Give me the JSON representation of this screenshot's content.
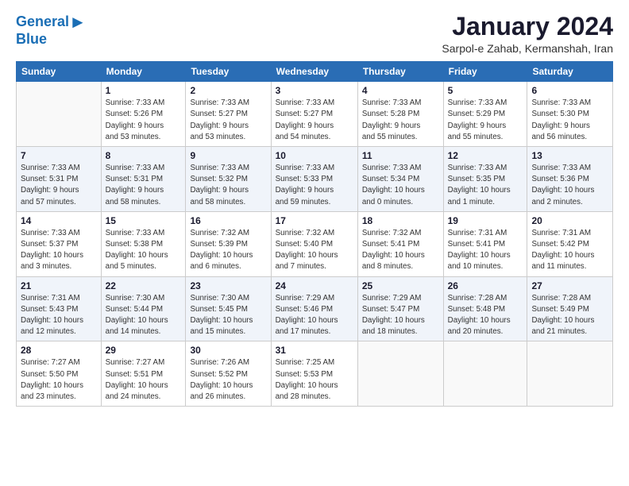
{
  "logo": {
    "line1": "General",
    "line2": "Blue"
  },
  "title": "January 2024",
  "location": "Sarpol-e Zahab, Kermanshah, Iran",
  "weekdays": [
    "Sunday",
    "Monday",
    "Tuesday",
    "Wednesday",
    "Thursday",
    "Friday",
    "Saturday"
  ],
  "weeks": [
    [
      {
        "day": "",
        "info": ""
      },
      {
        "day": "1",
        "info": "Sunrise: 7:33 AM\nSunset: 5:26 PM\nDaylight: 9 hours\nand 53 minutes."
      },
      {
        "day": "2",
        "info": "Sunrise: 7:33 AM\nSunset: 5:27 PM\nDaylight: 9 hours\nand 53 minutes."
      },
      {
        "day": "3",
        "info": "Sunrise: 7:33 AM\nSunset: 5:27 PM\nDaylight: 9 hours\nand 54 minutes."
      },
      {
        "day": "4",
        "info": "Sunrise: 7:33 AM\nSunset: 5:28 PM\nDaylight: 9 hours\nand 55 minutes."
      },
      {
        "day": "5",
        "info": "Sunrise: 7:33 AM\nSunset: 5:29 PM\nDaylight: 9 hours\nand 55 minutes."
      },
      {
        "day": "6",
        "info": "Sunrise: 7:33 AM\nSunset: 5:30 PM\nDaylight: 9 hours\nand 56 minutes."
      }
    ],
    [
      {
        "day": "7",
        "info": "Sunrise: 7:33 AM\nSunset: 5:31 PM\nDaylight: 9 hours\nand 57 minutes."
      },
      {
        "day": "8",
        "info": "Sunrise: 7:33 AM\nSunset: 5:31 PM\nDaylight: 9 hours\nand 58 minutes."
      },
      {
        "day": "9",
        "info": "Sunrise: 7:33 AM\nSunset: 5:32 PM\nDaylight: 9 hours\nand 58 minutes."
      },
      {
        "day": "10",
        "info": "Sunrise: 7:33 AM\nSunset: 5:33 PM\nDaylight: 9 hours\nand 59 minutes."
      },
      {
        "day": "11",
        "info": "Sunrise: 7:33 AM\nSunset: 5:34 PM\nDaylight: 10 hours\nand 0 minutes."
      },
      {
        "day": "12",
        "info": "Sunrise: 7:33 AM\nSunset: 5:35 PM\nDaylight: 10 hours\nand 1 minute."
      },
      {
        "day": "13",
        "info": "Sunrise: 7:33 AM\nSunset: 5:36 PM\nDaylight: 10 hours\nand 2 minutes."
      }
    ],
    [
      {
        "day": "14",
        "info": "Sunrise: 7:33 AM\nSunset: 5:37 PM\nDaylight: 10 hours\nand 3 minutes."
      },
      {
        "day": "15",
        "info": "Sunrise: 7:33 AM\nSunset: 5:38 PM\nDaylight: 10 hours\nand 5 minutes."
      },
      {
        "day": "16",
        "info": "Sunrise: 7:32 AM\nSunset: 5:39 PM\nDaylight: 10 hours\nand 6 minutes."
      },
      {
        "day": "17",
        "info": "Sunrise: 7:32 AM\nSunset: 5:40 PM\nDaylight: 10 hours\nand 7 minutes."
      },
      {
        "day": "18",
        "info": "Sunrise: 7:32 AM\nSunset: 5:41 PM\nDaylight: 10 hours\nand 8 minutes."
      },
      {
        "day": "19",
        "info": "Sunrise: 7:31 AM\nSunset: 5:41 PM\nDaylight: 10 hours\nand 10 minutes."
      },
      {
        "day": "20",
        "info": "Sunrise: 7:31 AM\nSunset: 5:42 PM\nDaylight: 10 hours\nand 11 minutes."
      }
    ],
    [
      {
        "day": "21",
        "info": "Sunrise: 7:31 AM\nSunset: 5:43 PM\nDaylight: 10 hours\nand 12 minutes."
      },
      {
        "day": "22",
        "info": "Sunrise: 7:30 AM\nSunset: 5:44 PM\nDaylight: 10 hours\nand 14 minutes."
      },
      {
        "day": "23",
        "info": "Sunrise: 7:30 AM\nSunset: 5:45 PM\nDaylight: 10 hours\nand 15 minutes."
      },
      {
        "day": "24",
        "info": "Sunrise: 7:29 AM\nSunset: 5:46 PM\nDaylight: 10 hours\nand 17 minutes."
      },
      {
        "day": "25",
        "info": "Sunrise: 7:29 AM\nSunset: 5:47 PM\nDaylight: 10 hours\nand 18 minutes."
      },
      {
        "day": "26",
        "info": "Sunrise: 7:28 AM\nSunset: 5:48 PM\nDaylight: 10 hours\nand 20 minutes."
      },
      {
        "day": "27",
        "info": "Sunrise: 7:28 AM\nSunset: 5:49 PM\nDaylight: 10 hours\nand 21 minutes."
      }
    ],
    [
      {
        "day": "28",
        "info": "Sunrise: 7:27 AM\nSunset: 5:50 PM\nDaylight: 10 hours\nand 23 minutes."
      },
      {
        "day": "29",
        "info": "Sunrise: 7:27 AM\nSunset: 5:51 PM\nDaylight: 10 hours\nand 24 minutes."
      },
      {
        "day": "30",
        "info": "Sunrise: 7:26 AM\nSunset: 5:52 PM\nDaylight: 10 hours\nand 26 minutes."
      },
      {
        "day": "31",
        "info": "Sunrise: 7:25 AM\nSunset: 5:53 PM\nDaylight: 10 hours\nand 28 minutes."
      },
      {
        "day": "",
        "info": ""
      },
      {
        "day": "",
        "info": ""
      },
      {
        "day": "",
        "info": ""
      }
    ]
  ]
}
